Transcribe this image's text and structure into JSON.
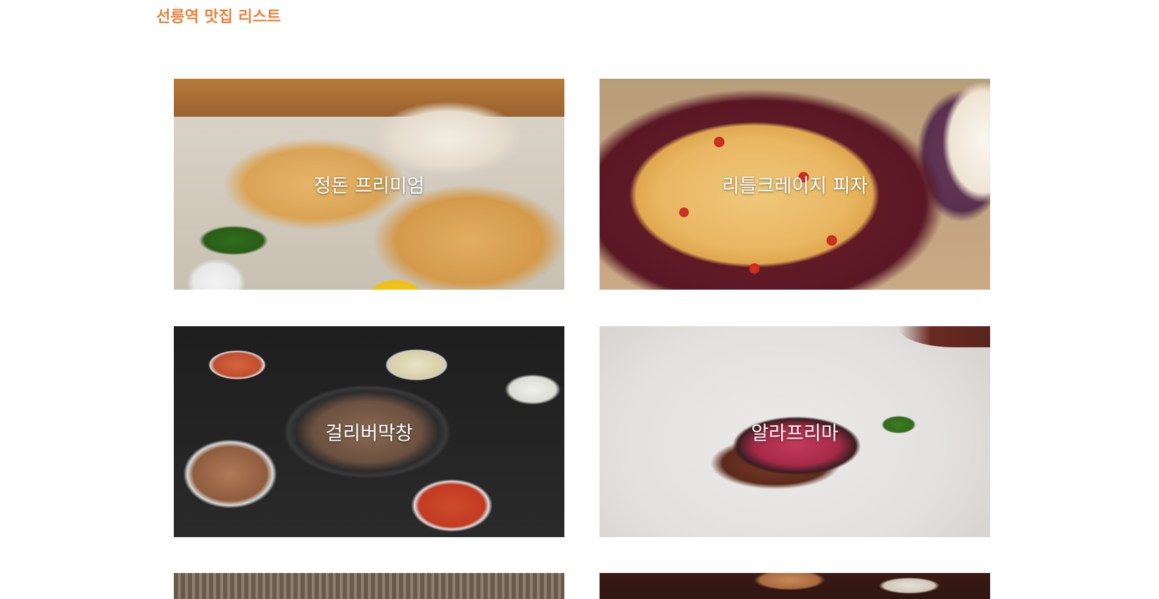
{
  "page": {
    "title": "선릉역 맛집 리스트"
  },
  "restaurants": [
    {
      "name": "정돈 프리미엄",
      "photo_icon": "tonkatsu-photo"
    },
    {
      "name": "리틀크레이지 피자",
      "photo_icon": "pizza-photo"
    },
    {
      "name": "걸리버막창",
      "photo_icon": "makchang-photo"
    },
    {
      "name": "알라프리마",
      "photo_icon": "steak-photo"
    },
    {
      "name": "",
      "photo_icon": "restaurant-photo"
    },
    {
      "name": "",
      "photo_icon": "restaurant-photo"
    }
  ],
  "colors": {
    "title": "#e8823a",
    "card_label": "#ffffff",
    "background": "#ffffff"
  }
}
